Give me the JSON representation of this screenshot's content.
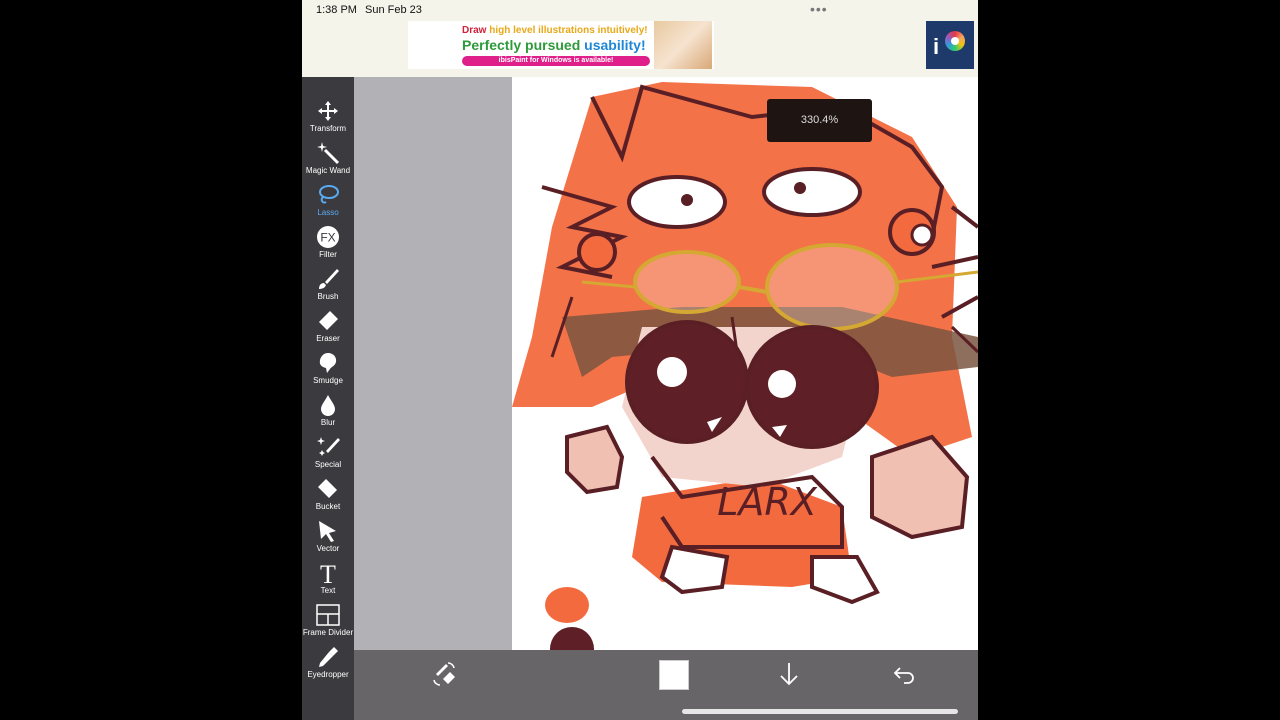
{
  "status_bar": {
    "time": "1:38 PM",
    "date": "Sun Feb 23",
    "more_icon": "ellipsis-icon"
  },
  "ad": {
    "line1_a": "Draw ",
    "line1_b": "high level illustrations intuitively!",
    "line2_a": "Perfectly pursued ",
    "line2_b": "usability!",
    "pill": "ibisPaint for Windows is available!",
    "logo_text": "i"
  },
  "tools": [
    {
      "label": "Transform",
      "icon": "move-arrows-icon"
    },
    {
      "label": "Magic Wand",
      "icon": "magic-wand-icon"
    },
    {
      "label": "Lasso",
      "icon": "lasso-icon",
      "selected": true
    },
    {
      "label": "Filter",
      "icon": "fx-icon"
    },
    {
      "label": "Brush",
      "icon": "brush-icon"
    },
    {
      "label": "Eraser",
      "icon": "eraser-icon"
    },
    {
      "label": "Smudge",
      "icon": "smudge-icon"
    },
    {
      "label": "Blur",
      "icon": "drop-icon"
    },
    {
      "label": "Special",
      "icon": "sparkle-pen-icon"
    },
    {
      "label": "Bucket",
      "icon": "bucket-icon"
    },
    {
      "label": "Vector",
      "icon": "cursor-icon"
    },
    {
      "label": "Text",
      "icon": "text-icon"
    },
    {
      "label": "Frame Divider",
      "icon": "frame-divider-icon"
    },
    {
      "label": "Eyedropper",
      "icon": "eyedropper-icon"
    }
  ],
  "fx_text": "FX",
  "text_tool_glyph": "T",
  "zoom_level": "330.4%",
  "canvas": {
    "lettering": "LARX"
  },
  "bottom_bar": {
    "swap_icon": "brush-eraser-swap-icon",
    "color_swatch": "#ffffff",
    "down_icon": "down-arrow-icon",
    "undo_icon": "undo-icon"
  },
  "colors": {
    "toolbar_bg": "#3b3b3f",
    "selected_tool": "#5aaaf0",
    "orange": "#f26a3e",
    "outline": "#5a1f25"
  }
}
